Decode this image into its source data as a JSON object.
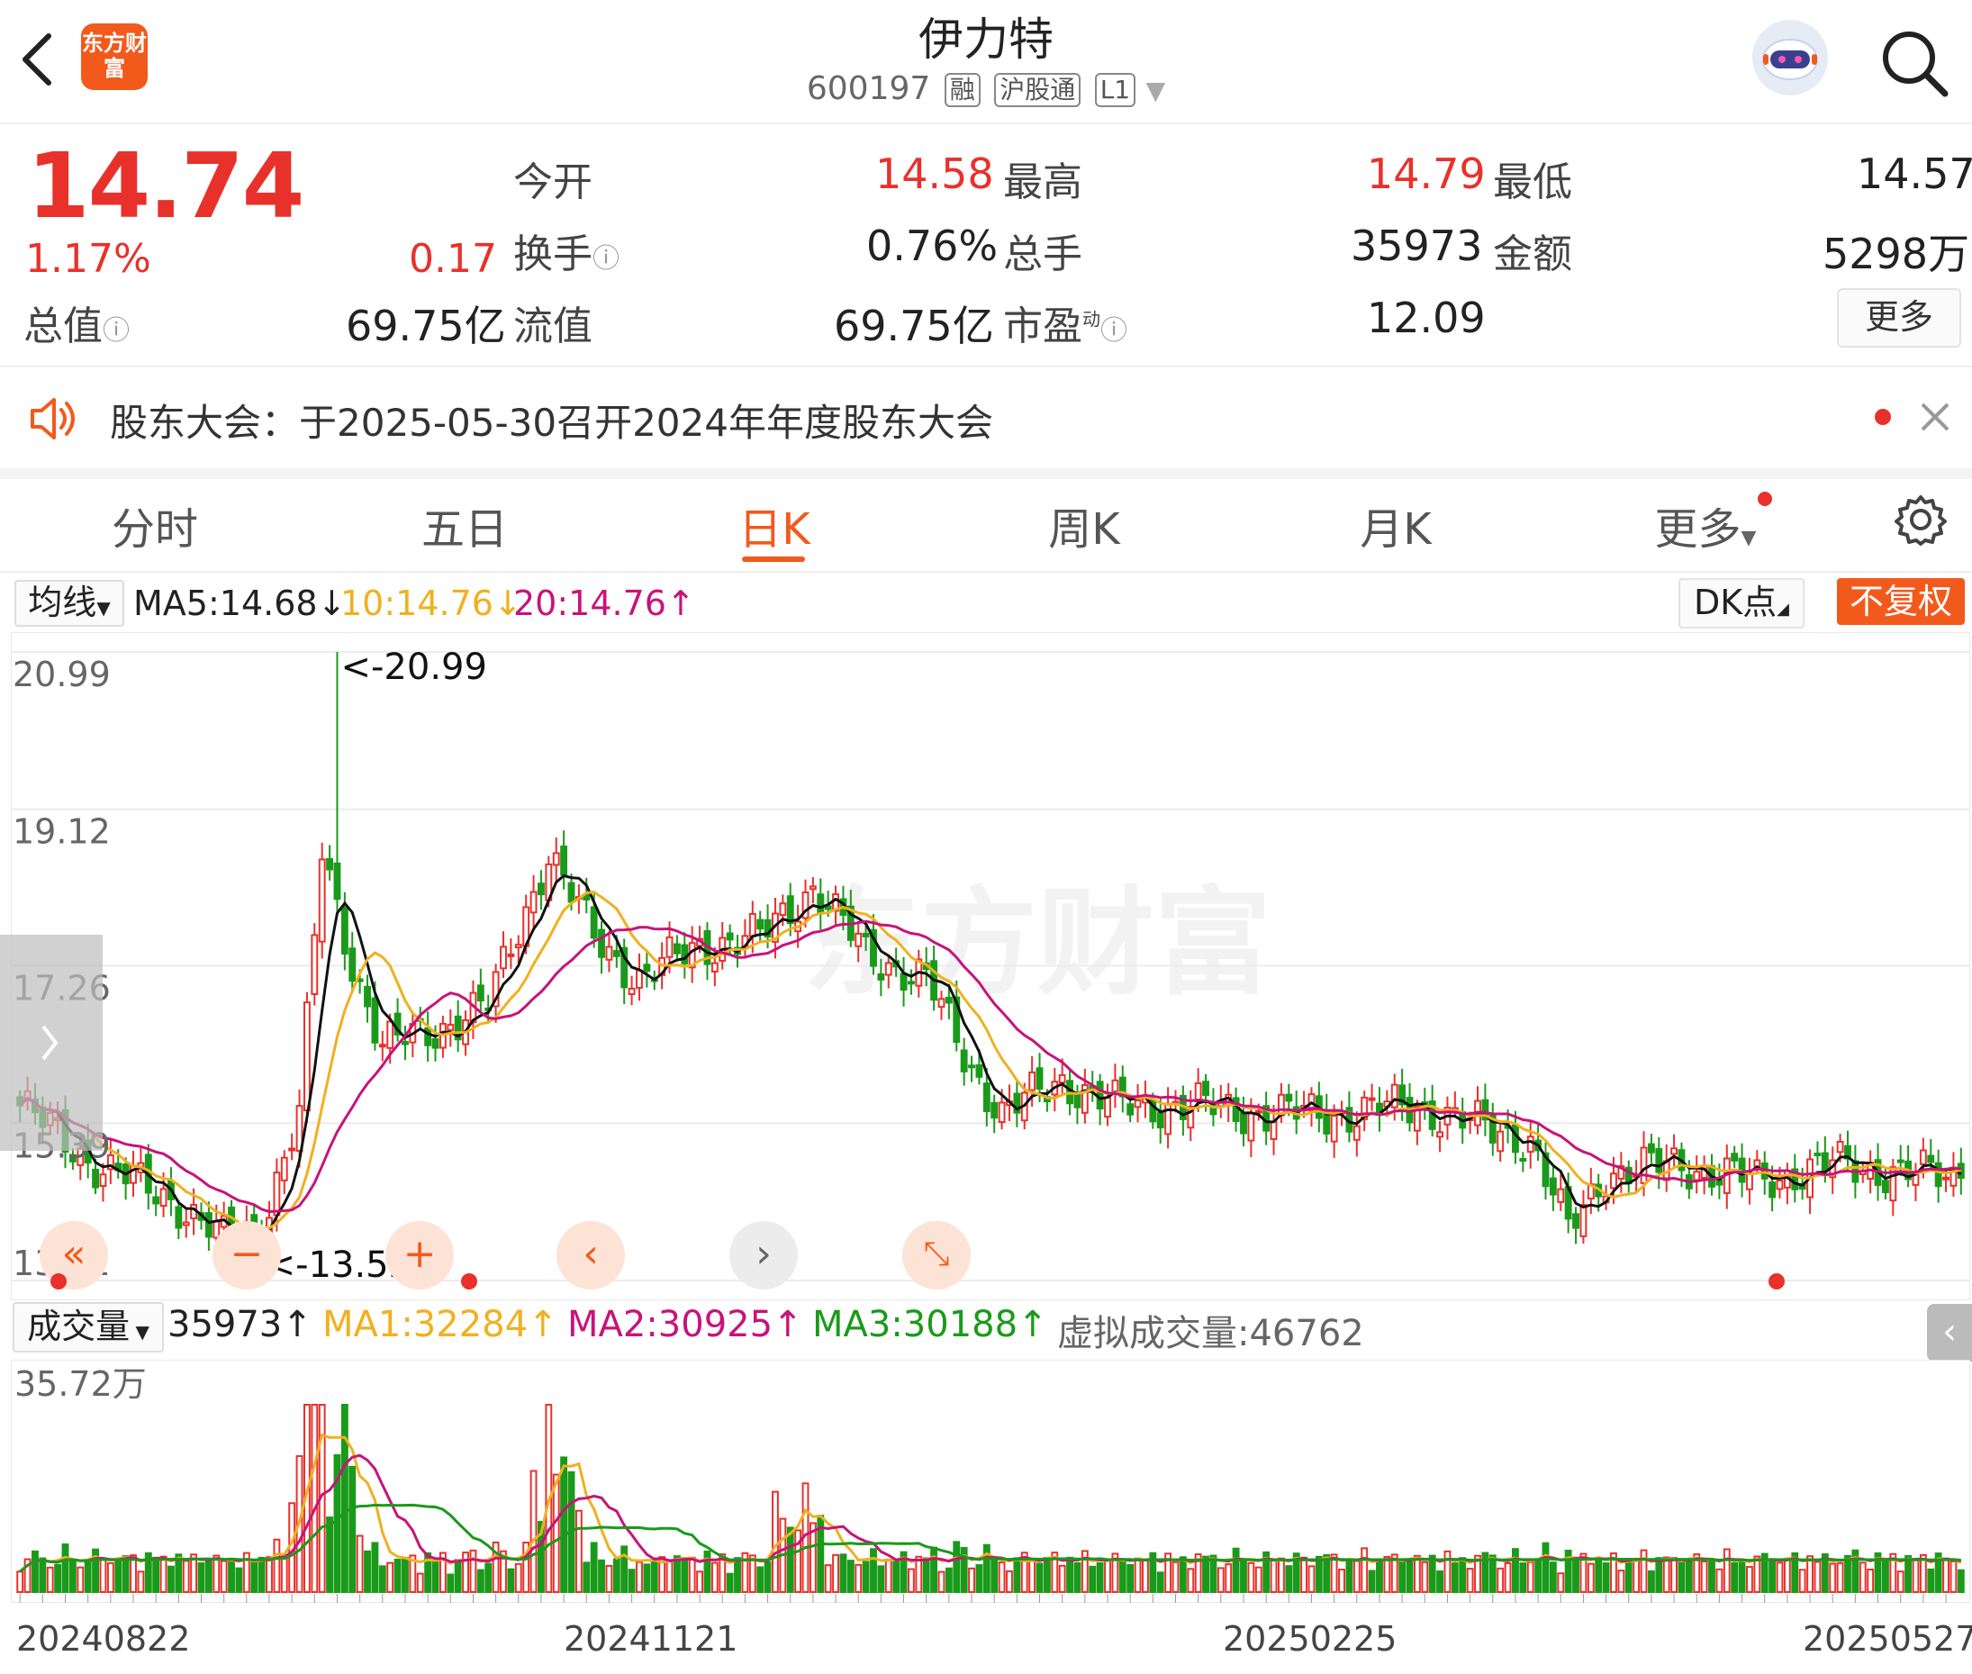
{
  "header": {
    "logo_text": "东方财富",
    "stock_name": "伊力特",
    "code": "600197",
    "tags": [
      "融",
      "沪股通",
      "L1"
    ]
  },
  "quote": {
    "price": "14.74",
    "change_pct": "1.17%",
    "change": "0.17",
    "fields": {
      "open_label": "今开",
      "open": "14.58",
      "high_label": "最高",
      "high": "14.79",
      "low_label": "最低",
      "low": "14.57",
      "turnover_label": "换手",
      "turnover": "0.76%",
      "volume_label": "总手",
      "volume": "35973",
      "amount_label": "金额",
      "amount": "5298万",
      "mktcap_label": "总值",
      "mktcap": "69.75亿",
      "float_label": "流值",
      "float": "69.75亿",
      "pe_label": "市盈",
      "pe_sup": "动",
      "pe": "12.09"
    },
    "more_label": "更多"
  },
  "notice": {
    "text": "股东大会：于2025-05-30召开2024年年度股东大会"
  },
  "tabs": [
    "分时",
    "五日",
    "日K",
    "周K",
    "月K",
    "更多"
  ],
  "active_tab": "日K",
  "ma_bar": {
    "dropdown": "均线",
    "ma5": "MA5:14.68↓",
    "ma10": "10:14.76↓",
    "ma20": "20:14.76↑",
    "dk": "DK点",
    "adjust": "不复权"
  },
  "colors": {
    "up": "#e8312b",
    "down": "#1a9a1a",
    "ma5": "#111111",
    "ma10": "#f0b020",
    "ma20": "#c8137a",
    "accent": "#f25a1c"
  },
  "watermark": "东方财富",
  "volume_bar": {
    "dropdown": "成交量",
    "current": "35973↑",
    "ma1": "MA1:32284↑",
    "ma2": "MA2:30925↑",
    "ma3": "MA3:30188↑",
    "virtual": "虚拟成交量:46762",
    "ymax_label": "35.72万"
  },
  "chart_data": {
    "type": "candlestick",
    "y_labels": [
      "20.99",
      "19.12",
      "17.26",
      "15.39",
      "13.52"
    ],
    "ylim": [
      13.52,
      20.99
    ],
    "x_labels": [
      "20240822",
      "20241121",
      "20250225",
      "20250527"
    ],
    "annotations": [
      "<-20.99",
      "<-13.52"
    ],
    "anchor_closes": [
      {
        "i": 0,
        "c": 15.6
      },
      {
        "i": 10,
        "c": 14.9
      },
      {
        "i": 20,
        "c": 14.5
      },
      {
        "i": 27,
        "c": 14.0
      },
      {
        "i": 32,
        "c": 14.2
      },
      {
        "i": 37,
        "c": 15.5
      },
      {
        "i": 40,
        "c": 18.6
      },
      {
        "i": 44,
        "c": 17.3
      },
      {
        "i": 48,
        "c": 16.3
      },
      {
        "i": 55,
        "c": 16.5
      },
      {
        "i": 62,
        "c": 16.8
      },
      {
        "i": 70,
        "c": 18.6
      },
      {
        "i": 76,
        "c": 17.6
      },
      {
        "i": 82,
        "c": 17.1
      },
      {
        "i": 90,
        "c": 17.5
      },
      {
        "i": 98,
        "c": 17.6
      },
      {
        "i": 105,
        "c": 18.2
      },
      {
        "i": 112,
        "c": 17.4
      },
      {
        "i": 120,
        "c": 17.1
      },
      {
        "i": 125,
        "c": 16.2
      },
      {
        "i": 130,
        "c": 15.5
      },
      {
        "i": 138,
        "c": 15.9
      },
      {
        "i": 145,
        "c": 15.6
      },
      {
        "i": 155,
        "c": 15.6
      },
      {
        "i": 165,
        "c": 15.5
      },
      {
        "i": 175,
        "c": 15.5
      },
      {
        "i": 185,
        "c": 15.6
      },
      {
        "i": 195,
        "c": 15.3
      },
      {
        "i": 200,
        "c": 15.2
      },
      {
        "i": 205,
        "c": 14.1
      },
      {
        "i": 210,
        "c": 14.8
      },
      {
        "i": 220,
        "c": 14.9
      },
      {
        "i": 230,
        "c": 14.7
      },
      {
        "i": 240,
        "c": 14.9
      },
      {
        "i": 250,
        "c": 14.8
      },
      {
        "i": 257,
        "c": 14.74
      }
    ],
    "volume_ymax": 357200
  }
}
